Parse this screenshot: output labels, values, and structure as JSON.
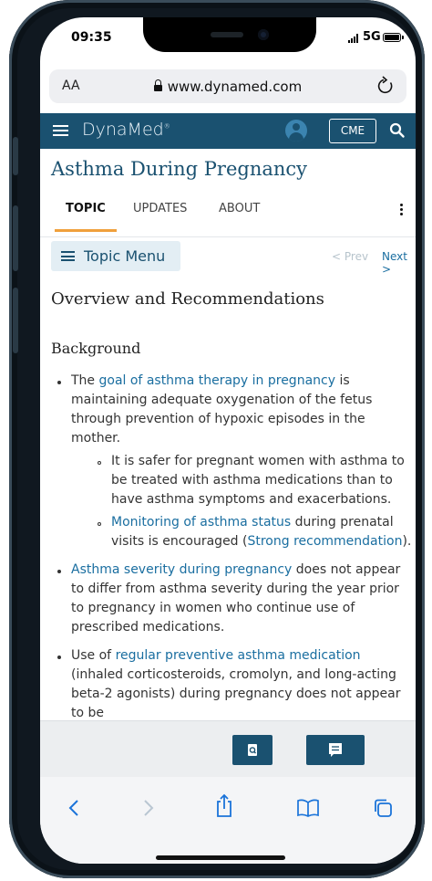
{
  "status": {
    "time": "09:35",
    "network": "5G"
  },
  "browser": {
    "text_size": "AA",
    "url": "www.dynamed.com"
  },
  "app": {
    "brand": "DynaMed",
    "cme_label": "CME"
  },
  "page": {
    "title": "Asthma During Pregnancy",
    "tabs": [
      "TOPIC",
      "UPDATES",
      "ABOUT"
    ],
    "topic_menu_label": "Topic Menu",
    "prev_label": "< Prev",
    "next_label": "Next >",
    "section_title": "Overview and Recommendations",
    "subsection_title": "Background"
  },
  "content": {
    "b1_pre": "The ",
    "b1_link": "goal of asthma therapy in pregnancy",
    "b1_post": " is maintaining adequate oxygenation of the fetus through prevention of hypoxic episodes in the mother.",
    "b1a": "It is safer for pregnant women with asthma to be treated with asthma medications than to have asthma symptoms and exacerbations.",
    "b1b_link": "Monitoring of asthma status",
    "b1b_mid": " during prenatal visits is encouraged (",
    "b1b_link2": "Strong recommendation",
    "b1b_end": ").",
    "b2_link": "Asthma severity during pregnancy",
    "b2_post": " does not appear to differ from asthma severity during the year prior to pregnancy in women who continue use of prescribed medications.",
    "b3_pre": "Use of ",
    "b3_link": "regular preventive asthma medication",
    "b3_post": " (inhaled corticosteroids, cromolyn, and long-acting beta-2 agonists) during pregnancy does not appear to be"
  },
  "colors": {
    "brand": "#1a5170",
    "link": "#1a6ea0",
    "tab_accent": "#f0a03c"
  },
  "icons": [
    "lock-icon",
    "reload-icon",
    "menu-icon",
    "user-icon",
    "search-icon",
    "find-icon",
    "chat-icon",
    "back-icon",
    "forward-icon",
    "share-icon",
    "bookmarks-icon",
    "tabs-icon"
  ]
}
